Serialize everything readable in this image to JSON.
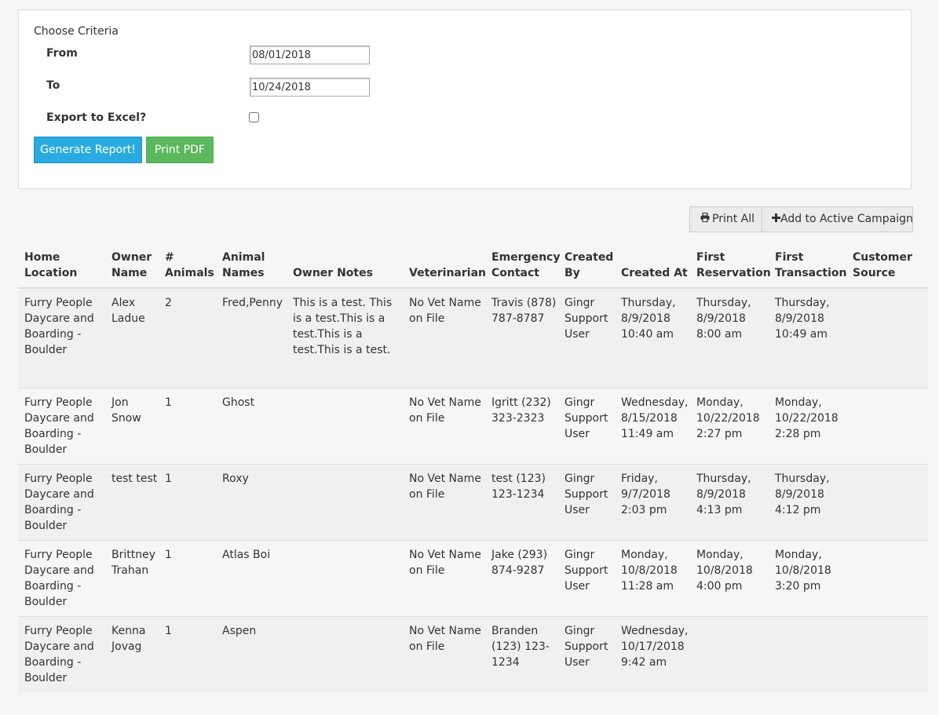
{
  "criteria": {
    "title": "Choose Criteria",
    "from_label": "From",
    "from_value": "08/01/2018",
    "to_label": "To",
    "to_value": "10/24/2018",
    "export_label": "Export to Excel?",
    "export_checked": false,
    "generate_label": "Generate Report!",
    "print_pdf_label": "Print PDF",
    "generate_color": "#29abe2",
    "print_pdf_color": "#5cb85c"
  },
  "actions": {
    "print_all_label": "Print All",
    "print_all_icon": "printer-icon",
    "add_campaign_label": "Add to Active Campaign",
    "add_campaign_icon": "plus-icon"
  },
  "table": {
    "headers": [
      "Home Location",
      "Owner Name",
      "# Animals",
      "Animal Names",
      "Owner Notes",
      "Veterinarian",
      "Emergency Contact",
      "Created By",
      "Created At",
      "First Reservation",
      "First Transaction",
      "Customer Source"
    ],
    "rows": [
      [
        "Furry People Daycare and Boarding - Boulder",
        "Alex Ladue",
        "2",
        "Fred,Penny",
        "This is a test. This is a test.This is a test.This is a test.This is a test.",
        "No Vet Name on File",
        "Travis (878) 787-8787",
        "Gingr Support User",
        "Thursday, 8/9/2018 10:40 am",
        "Thursday, 8/9/2018 8:00 am",
        "Thursday, 8/9/2018 10:49 am",
        ""
      ],
      [
        "Furry People Daycare and Boarding - Boulder",
        "Jon Snow",
        "1",
        "Ghost",
        "",
        "No Vet Name on File",
        "Igritt (232) 323-2323",
        "Gingr Support User",
        "Wednesday, 8/15/2018 11:49 am",
        "Monday, 10/22/2018 2:27 pm",
        "Monday, 10/22/2018 2:28 pm",
        ""
      ],
      [
        "Furry People Daycare and Boarding - Boulder",
        "test test",
        "1",
        "Roxy",
        "",
        "No Vet Name on File",
        "test (123) 123-1234",
        "Gingr Support User",
        "Friday, 9/7/2018 2:03 pm",
        "Thursday, 8/9/2018 4:13 pm",
        "Thursday, 8/9/2018 4:12 pm",
        ""
      ],
      [
        "Furry People Daycare and Boarding - Boulder",
        "Brittney Trahan",
        "1",
        "Atlas Boi",
        "",
        "No Vet Name on File",
        "Jake (293) 874-9287",
        "Gingr Support User",
        "Monday, 10/8/2018 11:28 am",
        "Monday, 10/8/2018 4:00 pm",
        "Monday, 10/8/2018 3:20 pm",
        ""
      ],
      [
        "Furry People Daycare and Boarding - Boulder",
        "Kenna Jovag",
        "1",
        "Aspen",
        "",
        "No Vet Name on File",
        "Branden (123) 123-1234",
        "Gingr Support User",
        "Wednesday, 10/17/2018 9:42 am",
        "",
        "",
        ""
      ]
    ]
  }
}
